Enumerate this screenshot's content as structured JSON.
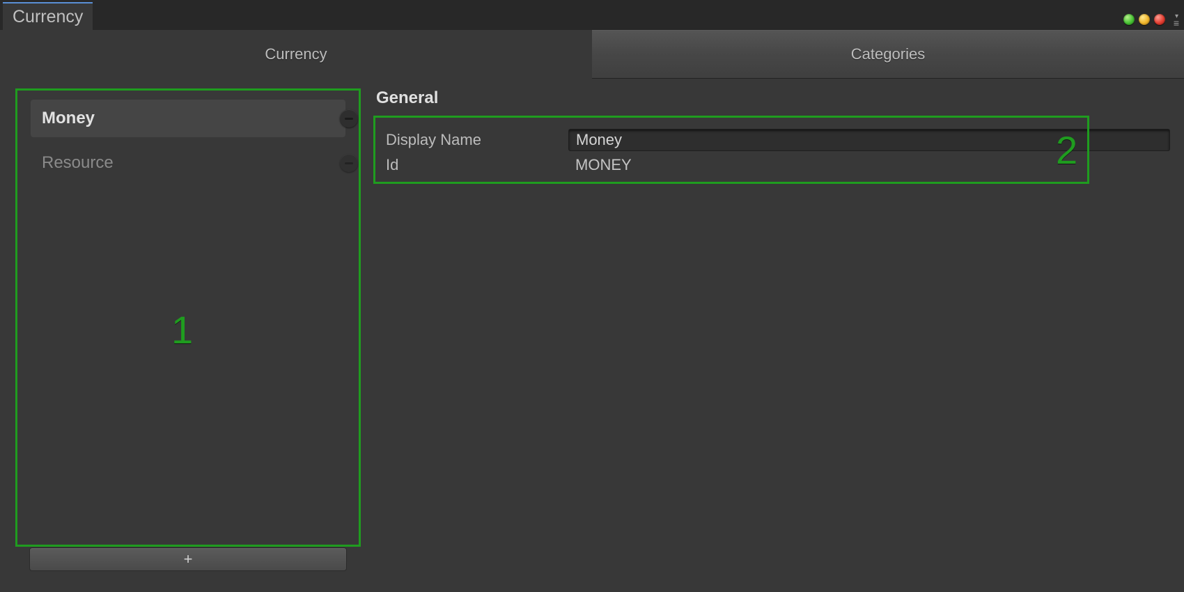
{
  "window": {
    "tab_title": "Currency"
  },
  "tabs": {
    "currency": "Currency",
    "categories": "Categories"
  },
  "sidebar": {
    "items": [
      {
        "label": "Money",
        "selected": true
      },
      {
        "label": "Resource",
        "selected": false
      }
    ],
    "add_label": "+"
  },
  "details": {
    "section_title": "General",
    "display_name_label": "Display Name",
    "display_name_value": "Money",
    "id_label": "Id",
    "id_value": "MONEY"
  },
  "annotations": {
    "box1": "1",
    "box2": "2"
  }
}
